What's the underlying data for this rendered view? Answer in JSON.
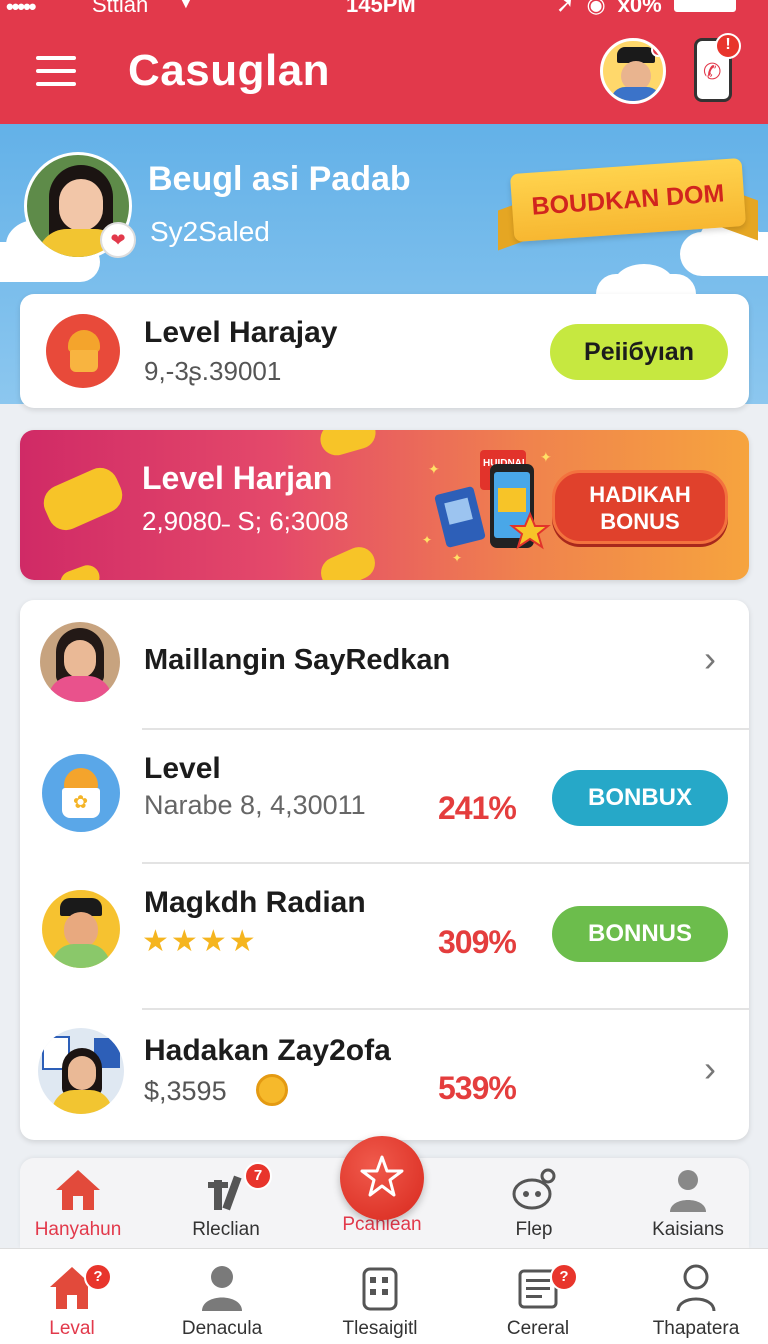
{
  "status_bar": {
    "signal": "•••••",
    "carrier": "Sttian",
    "time": "145PM",
    "battery_text": "x0%"
  },
  "header": {
    "title": "Casuglan",
    "phone_badge": "!"
  },
  "profile": {
    "name": "Beugl asi Padab",
    "subtitle": "Sy2Saled",
    "ribbon_text": "BOUDKAN DOM"
  },
  "level_card": {
    "title": "Level Harajay",
    "value": "9,-3ʂ.39001",
    "button_label": "Peiiбyıan"
  },
  "promo": {
    "title": "Level Harjan",
    "value": "2,9080˗ S; 6;3008",
    "button_label_line1": "HADIKAH",
    "button_label_line2": "BONUS",
    "card_text": "HUIDNAL"
  },
  "list": {
    "items": [
      {
        "title": "Maillangin SayRedkan",
        "subtitle": "",
        "percent": "",
        "button": ""
      },
      {
        "title": "Level",
        "subtitle": "Narabe 8, 4,30011",
        "percent": "241%",
        "button": "BONBUX"
      },
      {
        "title": "Magkdh Radian",
        "subtitle": "",
        "percent": "309%",
        "button": "BONNUS"
      },
      {
        "title": "Hadakan Zay2ofa",
        "subtitle": "$,3595",
        "percent": "539%",
        "button": ""
      }
    ]
  },
  "tabs_top": [
    {
      "label": "Hanyahun",
      "badge": ""
    },
    {
      "label": "Rleclian",
      "badge": "7"
    },
    {
      "label": "Pcaniean",
      "badge": ""
    },
    {
      "label": "Flep",
      "badge": ""
    },
    {
      "label": "Kaisians",
      "badge": ""
    }
  ],
  "tabs_bottom": [
    {
      "label": "Leval",
      "badge": "?"
    },
    {
      "label": "Denacula",
      "badge": ""
    },
    {
      "label": "Tlesaigitl",
      "badge": ""
    },
    {
      "label": "Cereral",
      "badge": "?"
    },
    {
      "label": "Thapatera",
      "badge": ""
    }
  ],
  "colors": {
    "header_red": "#e2394b",
    "sky": "#63b1e8",
    "lime": "#c6e840",
    "teal": "#26a8c8",
    "green": "#6cbd4c",
    "percent_red": "#e43d3d"
  }
}
